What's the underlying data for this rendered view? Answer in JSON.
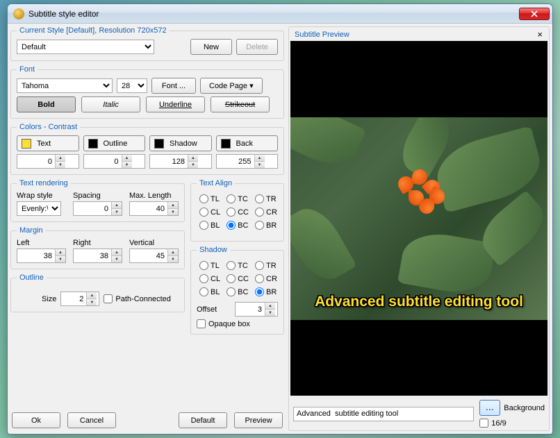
{
  "window": {
    "title": "Subtitle style editor"
  },
  "currentStyle": {
    "legend": "Current Style [Default], Resolution 720x572",
    "styleName": "Default",
    "new": "New",
    "delete": "Delete"
  },
  "font": {
    "legend": "Font",
    "name": "Tahoma",
    "size": "28",
    "fontBtn": "Font ...",
    "codePageBtn": "Code Page",
    "bold": "Bold",
    "italic": "Italic",
    "underline": "Underline",
    "strikeout": "Strikeout"
  },
  "colors": {
    "legend": "Colors - Contrast",
    "items": [
      {
        "label": "Text",
        "swatch": "#ffe030",
        "value": "0"
      },
      {
        "label": "Outline",
        "swatch": "#000000",
        "value": "0"
      },
      {
        "label": "Shadow",
        "swatch": "#000000",
        "value": "128"
      },
      {
        "label": "Back",
        "swatch": "#000000",
        "value": "255"
      }
    ]
  },
  "textRendering": {
    "legend": "Text rendering",
    "wrapLabel": "Wrap style",
    "wrapValue": "Evenly:\\N",
    "spacingLabel": "Spacing",
    "spacingValue": "0",
    "maxLenLabel": "Max. Length",
    "maxLenValue": "40"
  },
  "margin": {
    "legend": "Margin",
    "leftLabel": "Left",
    "leftValue": "38",
    "rightLabel": "Right",
    "rightValue": "38",
    "vertLabel": "Vertical",
    "vertValue": "45"
  },
  "outline": {
    "legend": "Outline",
    "sizeLabel": "Size",
    "sizeValue": "2",
    "pathConn": "Path-Connected"
  },
  "textAlign": {
    "legend": "Text Align",
    "options": [
      "TL",
      "TC",
      "TR",
      "CL",
      "CC",
      "CR",
      "BL",
      "BC",
      "BR"
    ],
    "selected": "BC"
  },
  "shadow": {
    "legend": "Shadow",
    "options": [
      "TL",
      "TC",
      "TR",
      "CL",
      "CC",
      "CR",
      "BL",
      "BC",
      "BR"
    ],
    "selected": "BR",
    "offsetLabel": "Offset",
    "offsetValue": "3",
    "opaque": "Opaque box"
  },
  "buttons": {
    "ok": "Ok",
    "cancel": "Cancel",
    "default": "Default",
    "preview": "Preview"
  },
  "preview": {
    "legend": "Subtitle Preview",
    "overlayText": "Advanced subtitle editing tool",
    "inputText": "Advanced  subtitle editing tool",
    "dots": "...",
    "background": "Background",
    "ratio": "16/9"
  }
}
